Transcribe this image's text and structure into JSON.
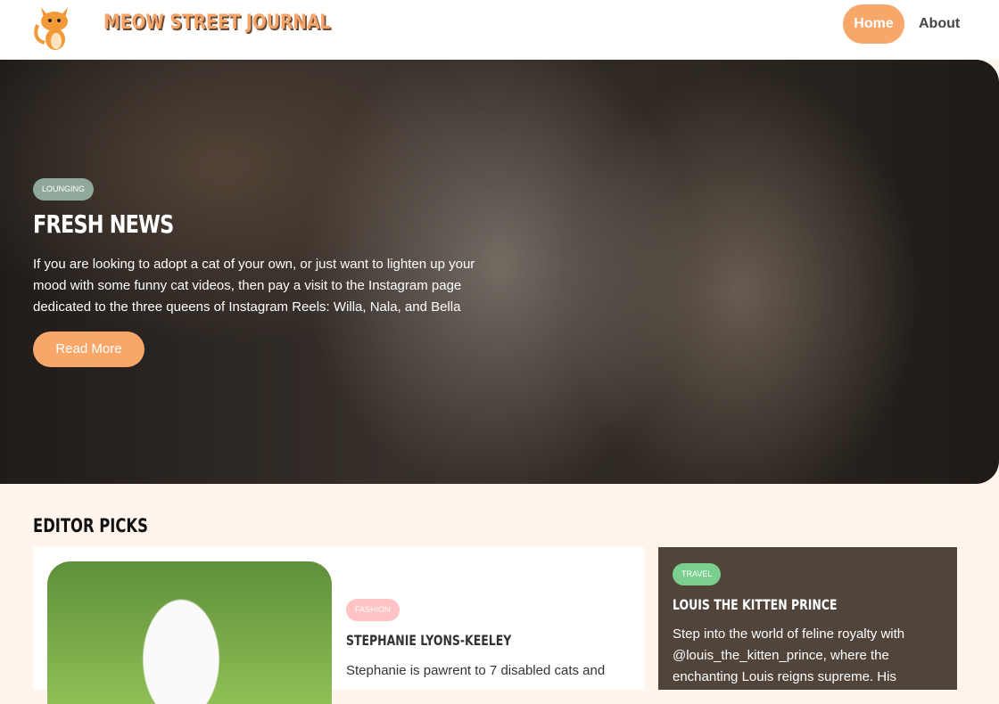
{
  "nav": {
    "brand": "MEOW STREET JOURNAL",
    "home": "Home",
    "about": "About"
  },
  "hero": {
    "tag": "LOUNGING",
    "title": "FRESH NEWS",
    "text": "If you are looking to adopt a cat of your own, or just want to lighten up your mood with some funny cat videos, then pay a visit to the Instagram page dedicated to the three queens of Instagram Reels: Willa, Nala, and Bella",
    "button": "Read More"
  },
  "editor": {
    "heading": "EDITOR PICKS",
    "card1": {
      "tag": "FASHION",
      "title": "STEPHANIE LYONS-KEELEY",
      "text": "Stephanie is pawrent to 7 disabled cats and"
    },
    "card2": {
      "tag": "TRAVEL",
      "title": "LOUIS THE KITTEN PRINCE",
      "text": "Step into the world of feline royalty with @louis_the_kitten_prince, where the enchanting Louis reigns supreme. His"
    }
  },
  "colors": {
    "accent": "#f7a76a",
    "lounging": "#8fa89a",
    "fashion": "#ffc3c3",
    "travel": "#7bcf8c",
    "dark_card": "#51443a"
  }
}
